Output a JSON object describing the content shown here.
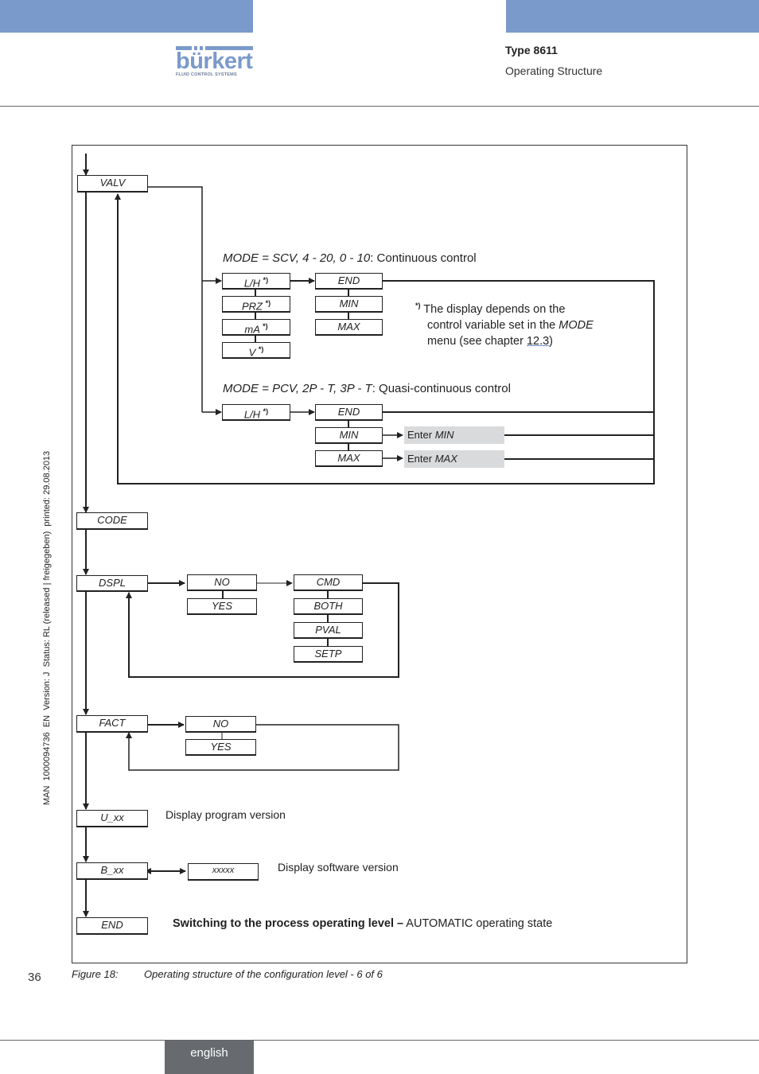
{
  "header": {
    "brand": "bürkert",
    "brand_tagline": "FLUID CONTROL SYSTEMS",
    "title": "Type 8611",
    "subtitle": "Operating Structure",
    "band_color": "#7a9acb"
  },
  "sidebar_meta": "MAN  1000094736  EN  Version: J  Status: RL (released | freigegeben)  printed: 29.08.2013",
  "diagram": {
    "main_menu": [
      "VALV",
      "CODE",
      "DSPL",
      "FACT",
      "U_xx",
      "B_xx",
      "END"
    ],
    "valv": {
      "mode_continuous": {
        "prefix": "MODE = SCV, 4 - 20, 0 - 10",
        "suffix": ": Continuous control"
      },
      "continuous_units": [
        "L/H",
        "PRZ",
        "mA",
        "V"
      ],
      "continuous_options": [
        "END",
        "MIN",
        "MAX"
      ],
      "footnote_mark": "*)",
      "footnote_line1": "The display depends on the",
      "footnote_line2_pre": "control variable set in the ",
      "footnote_line2_it": "MODE",
      "footnote_line3_pre": "menu (see chapter ",
      "footnote_link": "12.3",
      "footnote_line3_post": ")",
      "mode_quasi": {
        "prefix": "MODE = PCV, 2P - T, 3P - T",
        "suffix": ": Quasi-continuous control"
      },
      "quasi_unit": "L/H",
      "quasi_options": [
        "END",
        "MIN",
        "MAX"
      ],
      "enter_min": {
        "pre": "Enter ",
        "it": "MIN"
      },
      "enter_max": {
        "pre": "Enter ",
        "it": "MAX"
      }
    },
    "dspl": {
      "choices": [
        "NO",
        "YES"
      ],
      "options": [
        "CMD",
        "BOTH",
        "PVAL",
        "SETP"
      ]
    },
    "fact": {
      "choices": [
        "NO",
        "YES"
      ]
    },
    "u_xx_desc": "Display program version",
    "b_xx_value": "xxxxx",
    "b_xx_desc": "Display software version",
    "end_desc_bold": "Switching to the process operating level –",
    "end_desc_normal": " AUTOMATIC operating state"
  },
  "caption": {
    "label": "Figure 18:",
    "text": "Operating structure of the configuration level - 6 of 6"
  },
  "footer": {
    "page_number": "36",
    "language": "english"
  }
}
